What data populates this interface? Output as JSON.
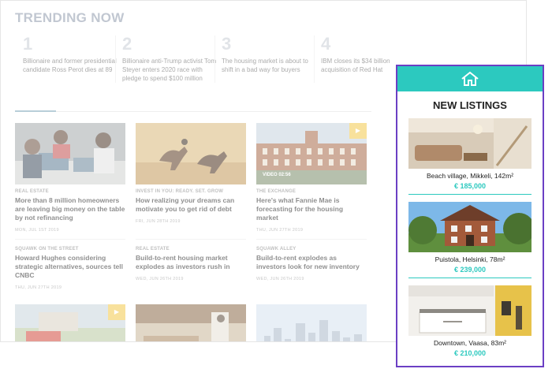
{
  "trending": {
    "title": "TRENDING NOW",
    "items": [
      {
        "num": "1",
        "text": "Billionaire and former presidential candidate Ross Perot dies at 89"
      },
      {
        "num": "2",
        "text": "Billionaire anti-Trump activist Tom Steyer enters 2020 race with pledge to spend $100 million"
      },
      {
        "num": "3",
        "text": "The housing market is about to shift in a bad way for buyers"
      },
      {
        "num": "4",
        "text": "IBM closes its $34 billion acquisition of Red Hat"
      }
    ]
  },
  "feed": {
    "cards": [
      {
        "kicker": "REAL ESTATE",
        "title": "More than 8 million homeowners are leaving big money on the table by not refinancing",
        "date": "MON, JUL 1ST 2019"
      },
      {
        "kicker": "INVEST IN YOU: READY. SET. GROW",
        "title": "How realizing your dreams can motivate you to get rid of debt",
        "date": "FRI, JUN 28TH 2019"
      },
      {
        "kicker": "THE EXCHANGE",
        "title": "Here's what Fannie Mae is forecasting for the housing market",
        "date": "THU, JUN 27TH 2019",
        "video_label": "VIDEO",
        "video_time": "02:56"
      }
    ],
    "text_cards": [
      {
        "kicker": "SQUAWK ON THE STREET",
        "title": "Howard Hughes considering strategic alternatives, sources tell CNBC",
        "date": "THU, JUN 27TH 2019"
      },
      {
        "kicker": "REAL ESTATE",
        "title": "Build-to-rent housing market explodes as investors rush in",
        "date": "WED, JUN 26TH 2019"
      },
      {
        "kicker": "SQUAWK ALLEY",
        "title": "Build-to-rent explodes as investors look for new inventory",
        "date": "WED, JUN 26TH 2019"
      }
    ]
  },
  "new_listings": {
    "title": "NEW LISTINGS",
    "icon": "house-icon",
    "accent": "#2cc9bf",
    "border": "#6b3fc4",
    "items": [
      {
        "name": "Beach village, Mikkeli, 142m²",
        "price": "€ 185,000"
      },
      {
        "name": "Puistola, Helsinki, 78m²",
        "price": "€ 239,000"
      },
      {
        "name": "Downtown, Vaasa, 83m²",
        "price": "€ 210,000"
      }
    ]
  }
}
